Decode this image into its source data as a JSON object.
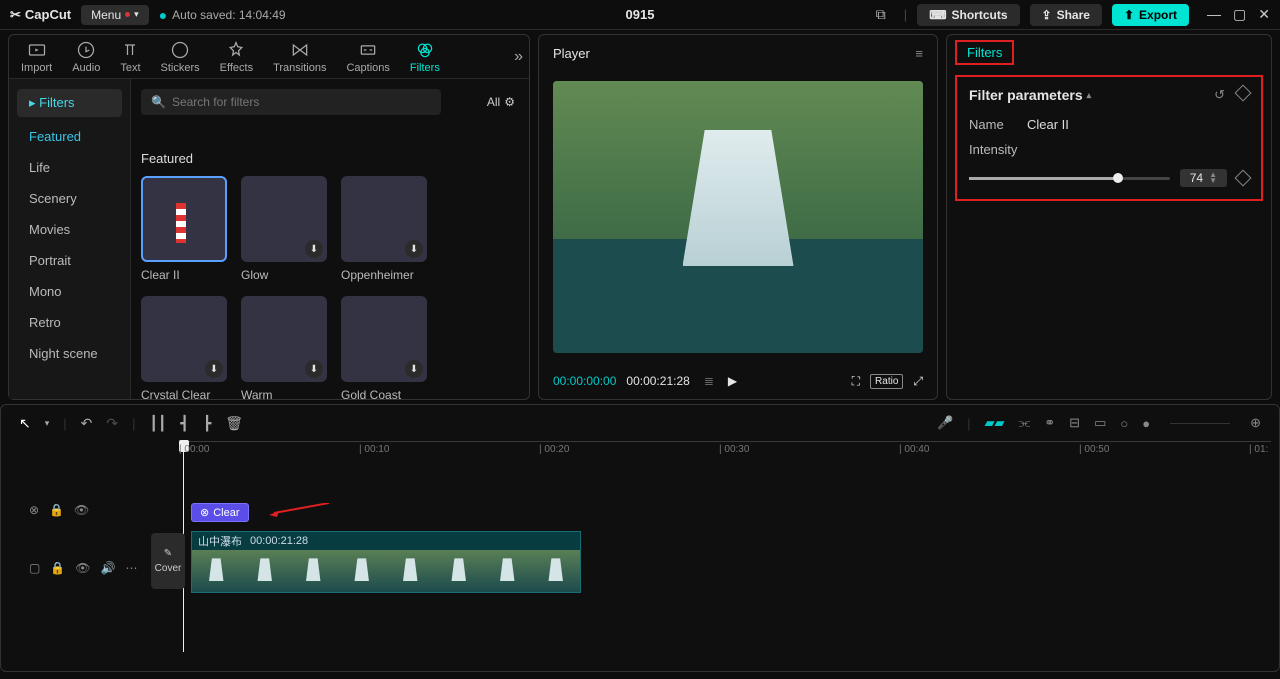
{
  "titlebar": {
    "app": "CapCut",
    "menu": "Menu",
    "autosaved": "Auto saved: 14:04:49",
    "project": "0915",
    "shortcuts": "Shortcuts",
    "share": "Share",
    "export": "Export"
  },
  "tabs": [
    "Import",
    "Audio",
    "Text",
    "Stickers",
    "Effects",
    "Transitions",
    "Captions",
    "Filters"
  ],
  "activeTab": "Filters",
  "filterNav": {
    "head": "Filters",
    "items": [
      "Featured",
      "Life",
      "Scenery",
      "Movies",
      "Portrait",
      "Mono",
      "Retro",
      "Night scene"
    ],
    "active": "Featured"
  },
  "search": {
    "placeholder": "Search for filters",
    "all": "All"
  },
  "section": "Featured",
  "thumbs": [
    {
      "label": "Clear II",
      "cls": "bg-light",
      "sel": true,
      "dl": false
    },
    {
      "label": "Glow",
      "cls": "bg-glow",
      "sel": false,
      "dl": true
    },
    {
      "label": "Oppenheimer",
      "cls": "bg-opp",
      "sel": false,
      "dl": true
    },
    {
      "label": "Crystal Clear",
      "cls": "bg-cc",
      "sel": false,
      "dl": true
    },
    {
      "label": "Warm",
      "cls": "bg-warm",
      "sel": false,
      "dl": true
    },
    {
      "label": "Gold Coast",
      "cls": "bg-gold",
      "sel": false,
      "dl": true
    }
  ],
  "player": {
    "title": "Player",
    "time_cur": "00:00:00:00",
    "time_dur": "00:00:21:28",
    "ratio": "Ratio"
  },
  "inspector": {
    "tab": "Filters",
    "section": "Filter parameters",
    "name_label": "Name",
    "name_value": "Clear II",
    "intensity_label": "Intensity",
    "intensity_value": "74"
  },
  "timeline": {
    "ticks": [
      {
        "label": "00:00",
        "pos": 0
      },
      {
        "label": "00:10",
        "pos": 180
      },
      {
        "label": "00:20",
        "pos": 360
      },
      {
        "label": "00:30",
        "pos": 540
      },
      {
        "label": "00:40",
        "pos": 720
      },
      {
        "label": "00:50",
        "pos": 900
      },
      {
        "label": "01:",
        "pos": 1070
      }
    ],
    "filter_chip": "Clear",
    "clip_name": "山中瀑布",
    "clip_dur": "00:00:21:28",
    "cover": "Cover"
  }
}
